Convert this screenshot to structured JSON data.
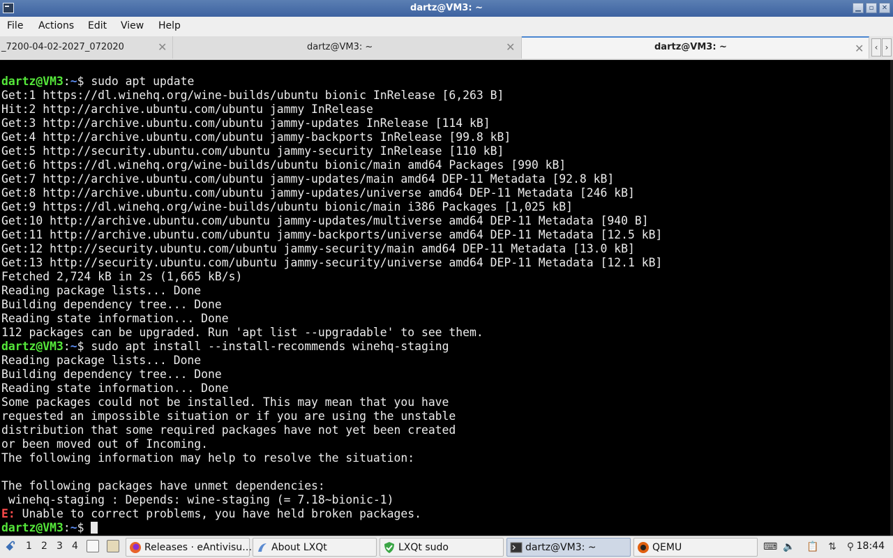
{
  "window": {
    "title": "dartz@VM3: ~",
    "buttons": {
      "minimize": "▁",
      "restore": "▫",
      "close": "✕"
    }
  },
  "menu": {
    "items": [
      "File",
      "Actions",
      "Edit",
      "View",
      "Help"
    ]
  },
  "tabs": [
    {
      "label": "_7200-04-02-2027_072020",
      "close": "✕",
      "active": false
    },
    {
      "label": "dartz@VM3: ~",
      "close": "✕",
      "active": false
    },
    {
      "label": "dartz@VM3: ~",
      "close": "✕",
      "active": true
    }
  ],
  "terminal": {
    "prompt_user": "dartz@VM3",
    "prompt_path": "~",
    "prompt_sep": ":",
    "prompt_symbol": "$ ",
    "cmd1": "sudo apt update",
    "output1": [
      "Get:1 https://dl.winehq.org/wine-builds/ubuntu bionic InRelease [6,263 B]",
      "Hit:2 http://archive.ubuntu.com/ubuntu jammy InRelease",
      "Get:3 http://archive.ubuntu.com/ubuntu jammy-updates InRelease [114 kB]",
      "Get:4 http://archive.ubuntu.com/ubuntu jammy-backports InRelease [99.8 kB]",
      "Get:5 http://security.ubuntu.com/ubuntu jammy-security InRelease [110 kB]",
      "Get:6 https://dl.winehq.org/wine-builds/ubuntu bionic/main amd64 Packages [990 kB]",
      "Get:7 http://archive.ubuntu.com/ubuntu jammy-updates/main amd64 DEP-11 Metadata [92.8 kB]",
      "Get:8 http://archive.ubuntu.com/ubuntu jammy-updates/universe amd64 DEP-11 Metadata [246 kB]",
      "Get:9 https://dl.winehq.org/wine-builds/ubuntu bionic/main i386 Packages [1,025 kB]",
      "Get:10 http://archive.ubuntu.com/ubuntu jammy-updates/multiverse amd64 DEP-11 Metadata [940 B]",
      "Get:11 http://archive.ubuntu.com/ubuntu jammy-backports/universe amd64 DEP-11 Metadata [12.5 kB]",
      "Get:12 http://security.ubuntu.com/ubuntu jammy-security/main amd64 DEP-11 Metadata [13.0 kB]",
      "Get:13 http://security.ubuntu.com/ubuntu jammy-security/universe amd64 DEP-11 Metadata [12.1 kB]",
      "Fetched 2,724 kB in 2s (1,665 kB/s)",
      "Reading package lists... Done",
      "Building dependency tree... Done",
      "Reading state information... Done",
      "112 packages can be upgraded. Run 'apt list --upgradable' to see them."
    ],
    "cmd2": "sudo apt install --install-recommends winehq-staging",
    "output2": [
      "Reading package lists... Done",
      "Building dependency tree... Done",
      "Reading state information... Done",
      "Some packages could not be installed. This may mean that you have",
      "requested an impossible situation or if you are using the unstable",
      "distribution that some required packages have not yet been created",
      "or been moved out of Incoming.",
      "The following information may help to resolve the situation:",
      "",
      "The following packages have unmet dependencies:",
      " winehq-staging : Depends: wine-staging (= 7.18~bionic-1)"
    ],
    "error_prefix": "E:",
    "error_text": " Unable to correct problems, you have held broken packages."
  },
  "taskbar": {
    "desktops": [
      "1",
      "2",
      "3",
      "4"
    ],
    "tasks": [
      {
        "label": "Releases · eAntivisu…",
        "icon": "firefox-icon",
        "active": false
      },
      {
        "label": "About LXQt",
        "icon": "lxqt-icon",
        "active": false
      },
      {
        "label": "LXQt sudo",
        "icon": "shield-icon",
        "active": false
      },
      {
        "label": "dartz@VM3: ~",
        "icon": "terminal-icon",
        "active": true
      },
      {
        "label": "QEMU",
        "icon": "qemu-icon",
        "active": false
      }
    ],
    "clock": "18:44"
  }
}
